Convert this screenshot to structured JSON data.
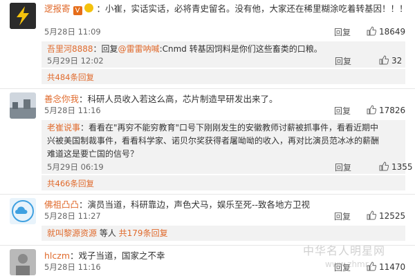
{
  "comments": [
    {
      "user": "逻报寄",
      "badge": "V",
      "separator": "：",
      "text": "小崔，实话实话，必将青史留名。没有他，大家还在稀里糊涂吃着转基因！！！",
      "date": "5月28日 11:09",
      "reply": "回复",
      "likes": "18649",
      "sub": {
        "user": "吾里河8888",
        "text_pre": "：回复",
        "at": "@雷雷呐喊",
        "text_post": ":Cnmd  转基因饲料是你们这些畜类的口粮。",
        "date": "5月29日 12:02",
        "reply": "回复",
        "likes": "32"
      },
      "more": "共484条回复"
    },
    {
      "user": "善念你我",
      "separator": "：",
      "text": "科研人员收入若这么高，芯片制造早研发出来了。",
      "date": "5月28日 11:16",
      "reply": "回复",
      "likes": "17826",
      "sub": {
        "user": "老崔说事",
        "lines": [
          "：看看在\"再穷不能穷教育\"口号下刚刚发生的安徽教师讨薪被抓事件，看看近期中",
          "兴被美国制裁事件，看看科学家、诺贝尔奖获得者屠呦呦的收入，再对比演员范冰冰的薪酬",
          "难道这是要亡国的信号？"
        ],
        "date": "5月29日 06:19",
        "reply": "回复",
        "likes": "1355"
      },
      "more": "共466条回复"
    },
    {
      "user": "佛祖凸凸",
      "separator": "：",
      "text": "演员当道，科研靠边，声色犬马，娱乐至死--致各地方卫视",
      "date": "5月28日 11:27",
      "reply": "回复",
      "likes": "12525",
      "sub": {
        "user": "就叫黎源资源",
        "text_post": " 等人",
        "more": " 共179条回复"
      }
    },
    {
      "user": "hlczm",
      "separator": "：",
      "text": "戏子当道，国家之不幸",
      "date": "5月28日 11:16",
      "reply": "回复",
      "likes": "11470"
    }
  ],
  "watermark": "中华名人明星网",
  "watermark2": "www.zhmr..."
}
